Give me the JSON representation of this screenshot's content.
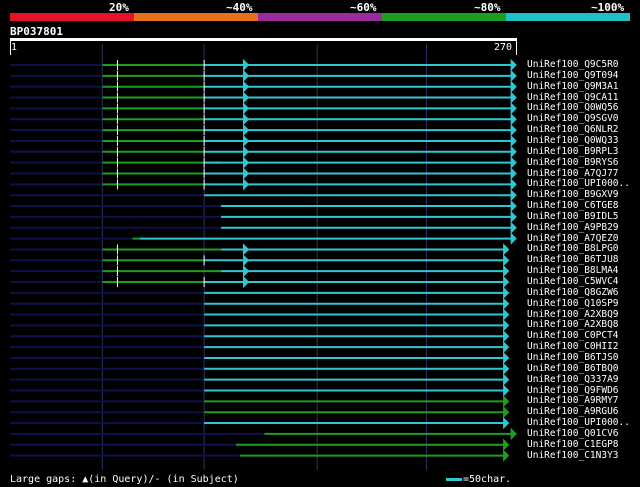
{
  "legend": {
    "segments": [
      {
        "label": "20%",
        "color": "#e8102a"
      },
      {
        "label": "~40%",
        "color": "#e8701c"
      },
      {
        "label": "~60%",
        "color": "#9a2aa0"
      },
      {
        "label": "~80%",
        "color": "#1e9e1e"
      },
      {
        "label": "~100%",
        "color": "#20c0c8"
      }
    ]
  },
  "query": {
    "id": "BP037801",
    "start": "1",
    "end": "270"
  },
  "colors": {
    "line": "#10104a",
    "green": "#1e9e1e",
    "cyan": "#30c8d0",
    "grid": "#303060"
  },
  "hits": [
    {
      "name": "UniRef100_Q9C5R0",
      "dark": [
        1,
        50
      ],
      "green": [
        50,
        104
      ],
      "cyan": [
        104,
        269
      ],
      "marks": [
        58,
        104
      ],
      "arrow": [
        127,
        269
      ]
    },
    {
      "name": "UniRef100_Q9T094",
      "dark": [
        1,
        50
      ],
      "green": [
        50,
        104
      ],
      "cyan": [
        104,
        269
      ],
      "marks": [
        58,
        104
      ],
      "arrow": [
        127,
        269
      ]
    },
    {
      "name": "UniRef100_Q9M3A1",
      "dark": [
        1,
        50
      ],
      "green": [
        50,
        104
      ],
      "cyan": [
        104,
        269
      ],
      "marks": [
        58,
        104
      ],
      "arrow": [
        127,
        269
      ]
    },
    {
      "name": "UniRef100_Q9CA11",
      "dark": [
        1,
        50
      ],
      "green": [
        50,
        104
      ],
      "cyan": [
        104,
        269
      ],
      "marks": [
        58,
        104
      ],
      "arrow": [
        127,
        269
      ]
    },
    {
      "name": "UniRef100_Q0WQ56",
      "dark": [
        1,
        50
      ],
      "green": [
        50,
        104
      ],
      "cyan": [
        104,
        269
      ],
      "marks": [
        58,
        104
      ],
      "arrow": [
        127,
        269
      ]
    },
    {
      "name": "UniRef100_Q9SGV0",
      "dark": [
        1,
        50
      ],
      "green": [
        50,
        104
      ],
      "cyan": [
        104,
        269
      ],
      "marks": [
        58,
        104
      ],
      "arrow": [
        127,
        269
      ]
    },
    {
      "name": "UniRef100_Q6NLR2",
      "dark": [
        1,
        50
      ],
      "green": [
        50,
        104
      ],
      "cyan": [
        104,
        269
      ],
      "marks": [
        58,
        104
      ],
      "arrow": [
        127,
        269
      ]
    },
    {
      "name": "UniRef100_Q0WQ33",
      "dark": [
        1,
        50
      ],
      "green": [
        50,
        104
      ],
      "cyan": [
        104,
        269
      ],
      "marks": [
        58,
        104
      ],
      "arrow": [
        127,
        269
      ]
    },
    {
      "name": "UniRef100_B9RPL3",
      "dark": [
        1,
        50
      ],
      "green": [
        50,
        104
      ],
      "cyan": [
        104,
        269
      ],
      "marks": [
        58,
        104
      ],
      "arrow": [
        127,
        269
      ]
    },
    {
      "name": "UniRef100_B9RYS6",
      "dark": [
        1,
        50
      ],
      "green": [
        50,
        113
      ],
      "cyan": [
        104,
        269
      ],
      "marks": [
        58,
        104
      ],
      "arrow": [
        127,
        269
      ]
    },
    {
      "name": "UniRef100_A7QJ77",
      "dark": [
        1,
        50
      ],
      "green": [
        50,
        104
      ],
      "cyan": [
        104,
        269
      ],
      "marks": [
        58,
        104
      ],
      "arrow": [
        127,
        269
      ]
    },
    {
      "name": "UniRef100_UPI000..",
      "dark": [
        1,
        50
      ],
      "green": [
        50,
        104
      ],
      "cyan": [
        104,
        269
      ],
      "marks": [
        58,
        104
      ],
      "arrow": [
        127,
        269
      ]
    },
    {
      "name": "UniRef100_B9GXV9",
      "dark": [
        1,
        104
      ],
      "green": null,
      "cyan": [
        104,
        269
      ],
      "marks": [],
      "arrow": [
        269
      ]
    },
    {
      "name": "UniRef100_C6TGE8",
      "dark": [
        1,
        113
      ],
      "green": null,
      "cyan": [
        113,
        269
      ],
      "marks": [],
      "arrow": [
        269
      ]
    },
    {
      "name": "UniRef100_B9IDL5",
      "dark": [
        1,
        113
      ],
      "green": null,
      "cyan": [
        113,
        269
      ],
      "marks": [],
      "arrow": [
        269
      ]
    },
    {
      "name": "UniRef100_A9PB29",
      "dark": [
        1,
        113
      ],
      "green": null,
      "cyan": [
        113,
        269
      ],
      "marks": [],
      "arrow": [
        269
      ]
    },
    {
      "name": "UniRef100_A7QEZ0",
      "dark": [
        1,
        66
      ],
      "green": [
        66,
        70
      ],
      "cyan": [
        70,
        269
      ],
      "marks": [],
      "arrow": [
        269
      ]
    },
    {
      "name": "UniRef100_B8LPG0",
      "dark": [
        1,
        50
      ],
      "green": [
        50,
        113
      ],
      "cyan": [
        113,
        265
      ],
      "marks": [
        58
      ],
      "arrow": [
        127,
        265
      ]
    },
    {
      "name": "UniRef100_B6TJU8",
      "dark": [
        1,
        50
      ],
      "green": [
        50,
        104
      ],
      "cyan": [
        104,
        265
      ],
      "marks": [
        58,
        104
      ],
      "arrow": [
        127,
        265
      ]
    },
    {
      "name": "UniRef100_B8LMA4",
      "dark": [
        1,
        50
      ],
      "green": [
        50,
        113
      ],
      "cyan": [
        113,
        265
      ],
      "marks": [
        58
      ],
      "arrow": [
        127,
        265
      ]
    },
    {
      "name": "UniRef100_C5WVC4",
      "dark": [
        1,
        50
      ],
      "green": [
        50,
        104
      ],
      "cyan": [
        104,
        265
      ],
      "marks": [
        58,
        104
      ],
      "arrow": [
        127,
        265
      ]
    },
    {
      "name": "UniRef100_Q8GZW6",
      "dark": [
        1,
        104
      ],
      "green": null,
      "cyan": [
        104,
        265
      ],
      "marks": [],
      "arrow": [
        265
      ]
    },
    {
      "name": "UniRef100_Q10SP9",
      "dark": [
        1,
        104
      ],
      "green": null,
      "cyan": [
        104,
        265
      ],
      "marks": [],
      "arrow": [
        265
      ]
    },
    {
      "name": "UniRef100_A2XBQ9",
      "dark": [
        1,
        104
      ],
      "green": null,
      "cyan": [
        104,
        265
      ],
      "marks": [],
      "arrow": [
        265
      ]
    },
    {
      "name": "UniRef100_A2XBQ8",
      "dark": [
        1,
        104
      ],
      "green": null,
      "cyan": [
        104,
        265
      ],
      "marks": [],
      "arrow": [
        265
      ]
    },
    {
      "name": "UniRef100_C0PCT4",
      "dark": [
        1,
        104
      ],
      "green": null,
      "cyan": [
        104,
        265
      ],
      "marks": [],
      "arrow": [
        265
      ]
    },
    {
      "name": "UniRef100_C0HII2",
      "dark": [
        1,
        104
      ],
      "green": null,
      "cyan": [
        104,
        265
      ],
      "marks": [],
      "arrow": [
        265
      ]
    },
    {
      "name": "UniRef100_B6TJS0",
      "dark": [
        1,
        104
      ],
      "green": null,
      "cyan": [
        104,
        265
      ],
      "marks": [],
      "arrow": [
        265
      ]
    },
    {
      "name": "UniRef100_B6TBQ0",
      "dark": [
        1,
        104
      ],
      "green": null,
      "cyan": [
        104,
        265
      ],
      "marks": [],
      "arrow": [
        265
      ]
    },
    {
      "name": "UniRef100_Q337A9",
      "dark": [
        1,
        104
      ],
      "green": null,
      "cyan": [
        104,
        265
      ],
      "marks": [],
      "arrow": [
        265
      ]
    },
    {
      "name": "UniRef100_Q9FWD6",
      "dark": [
        1,
        104
      ],
      "green": null,
      "cyan": [
        104,
        265
      ],
      "marks": [],
      "arrow": [
        265
      ]
    },
    {
      "name": "UniRef100_A9RMY7",
      "dark": [
        1,
        104
      ],
      "green": [
        104,
        265
      ],
      "cyan": null,
      "marks": [],
      "arrow": [
        265
      ]
    },
    {
      "name": "UniRef100_A9RGU6",
      "dark": [
        1,
        104
      ],
      "green": [
        104,
        265
      ],
      "cyan": null,
      "marks": [],
      "arrow": [
        265
      ]
    },
    {
      "name": "UniRef100_UPI000..",
      "dark": [
        1,
        104
      ],
      "green": null,
      "cyan": [
        104,
        265
      ],
      "marks": [],
      "arrow": [
        265
      ]
    },
    {
      "name": "UniRef100_Q01CV6",
      "dark": [
        1,
        136
      ],
      "green": [
        136,
        269
      ],
      "cyan": null,
      "marks": [],
      "arrow": [
        269
      ]
    },
    {
      "name": "UniRef100_C1EGP8",
      "dark": [
        1,
        121
      ],
      "green": [
        121,
        265
      ],
      "cyan": null,
      "marks": [],
      "arrow": [
        265
      ]
    },
    {
      "name": "UniRef100_C1N3Y3",
      "dark": [
        1,
        123
      ],
      "green": [
        123,
        265
      ],
      "cyan": null,
      "marks": [],
      "arrow": [
        265
      ]
    }
  ],
  "footer": {
    "gaps_text": "Large gaps: ▲(in Query)/- (in Subject)",
    "scale_text": "=50char."
  }
}
